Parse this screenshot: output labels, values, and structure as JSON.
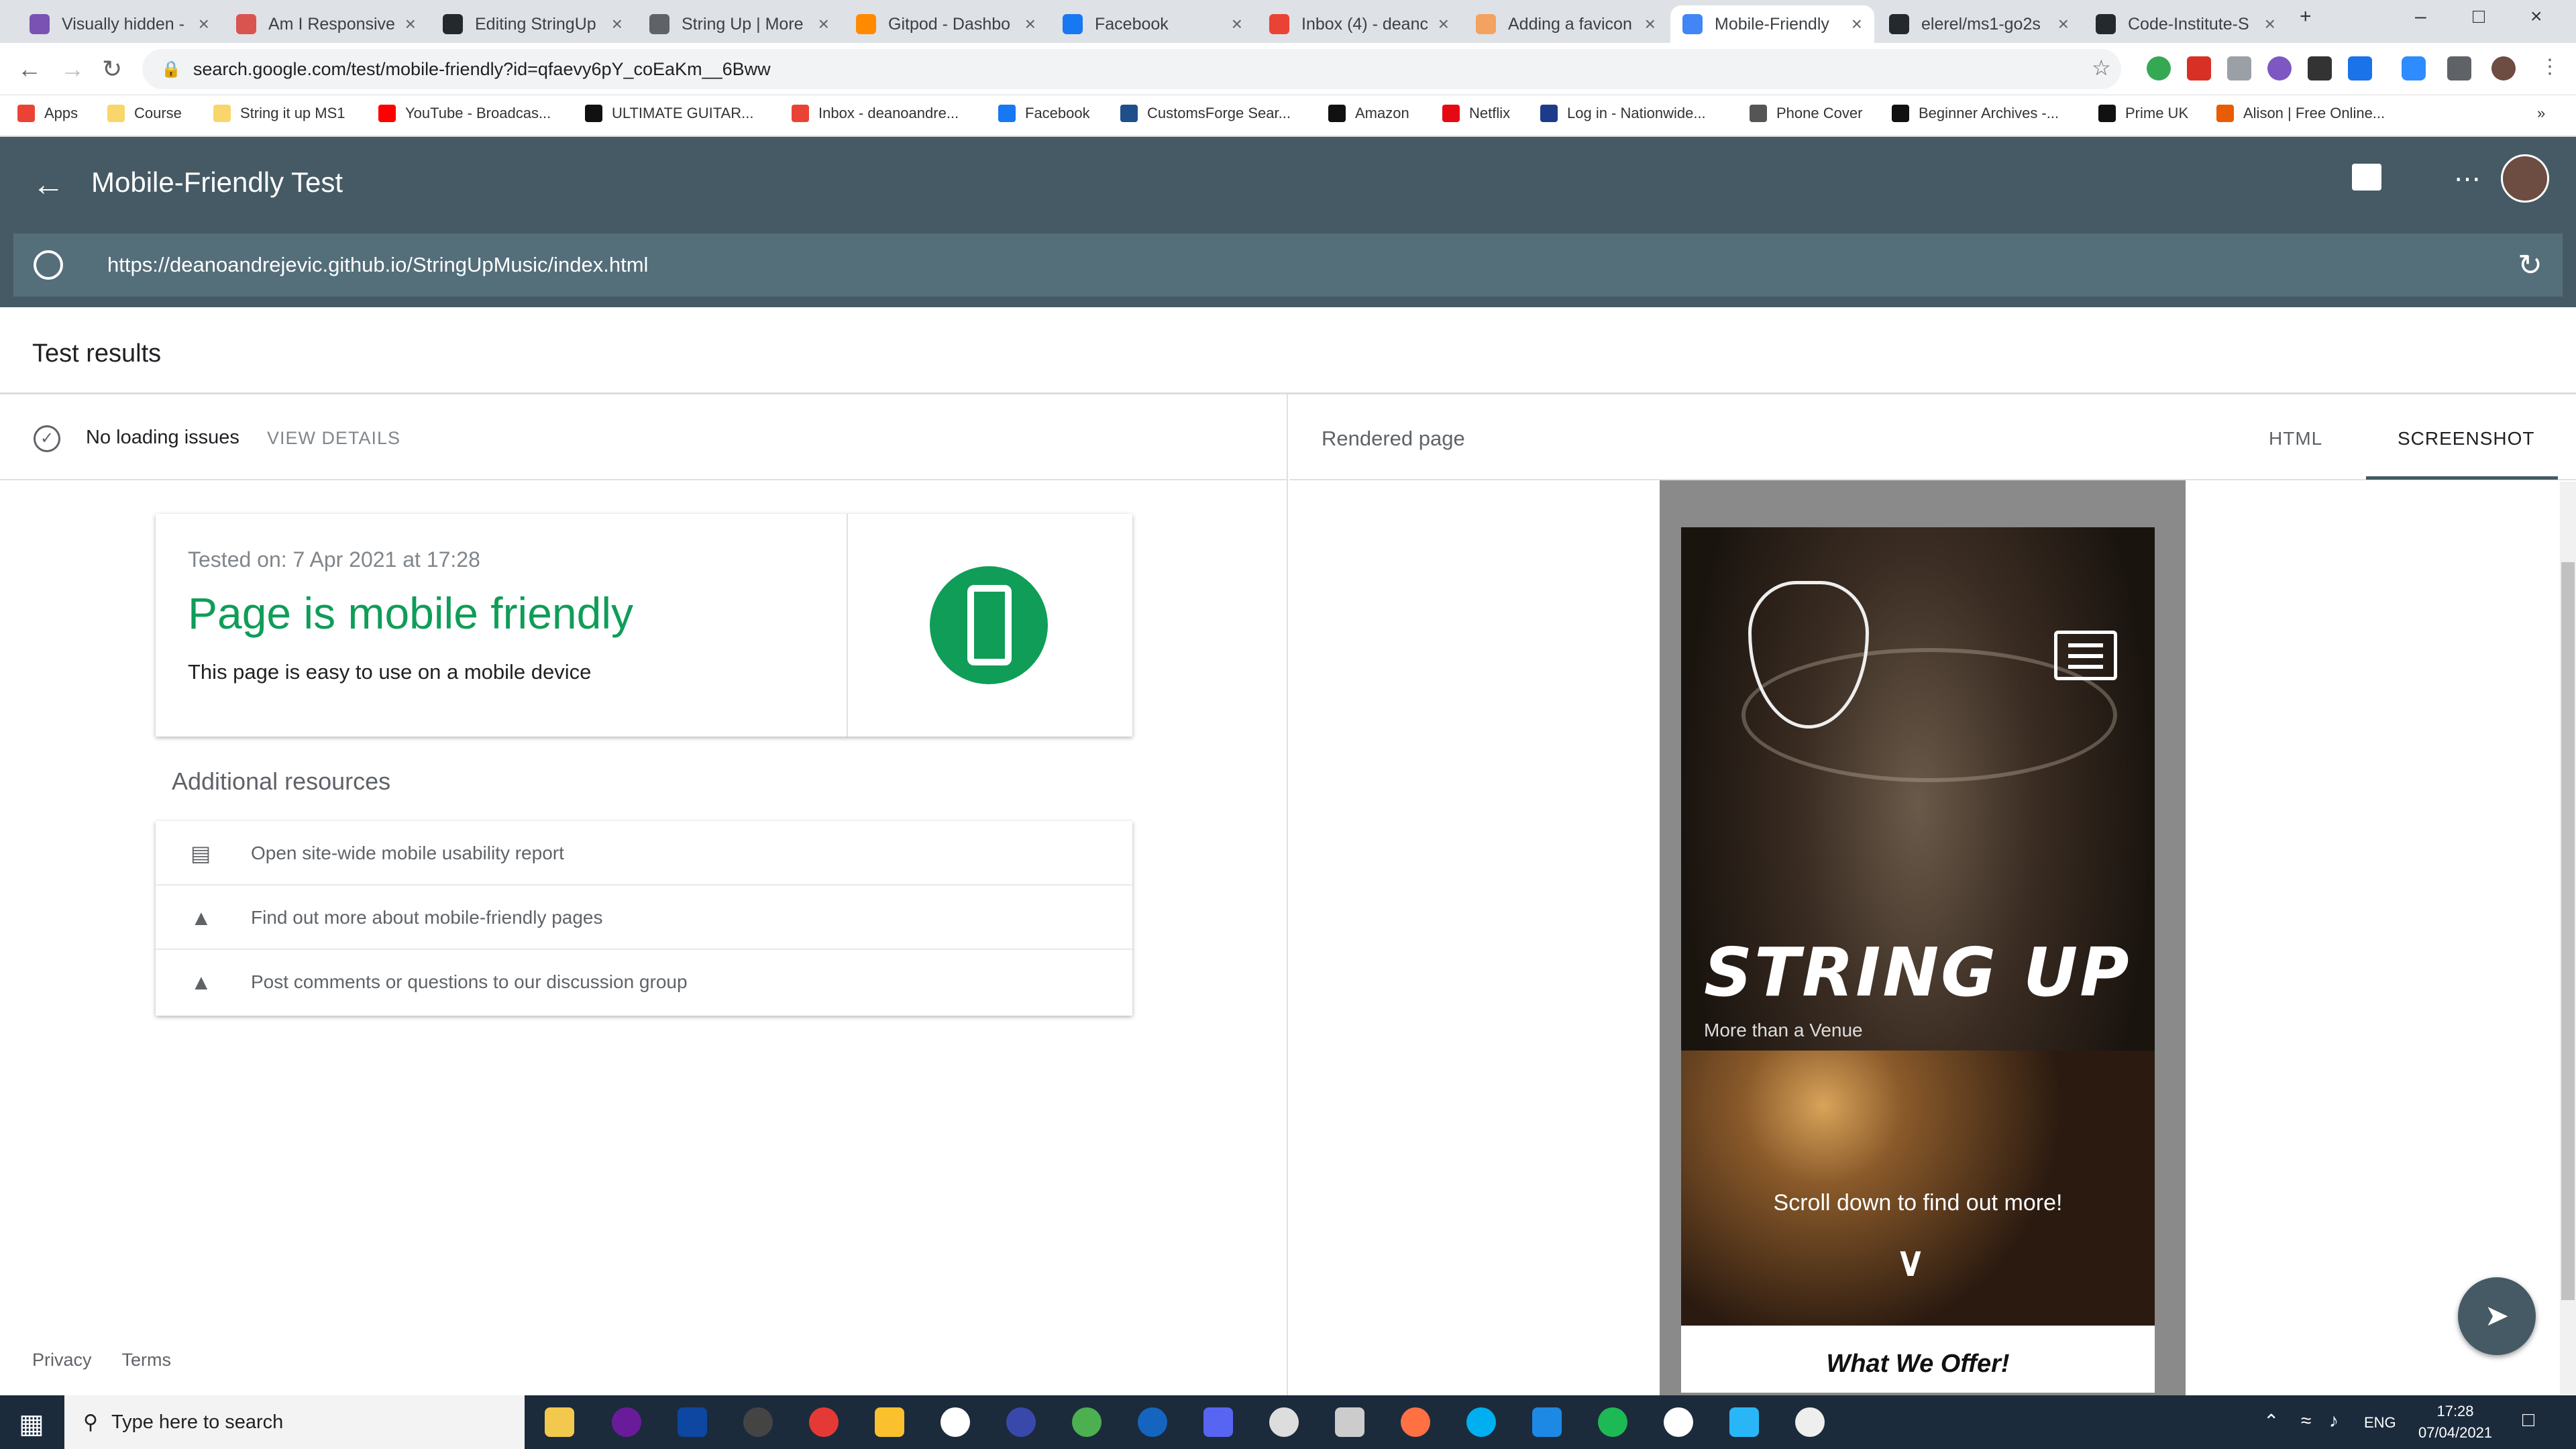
{
  "browser": {
    "tabs": [
      {
        "label": "Visually hidden -",
        "color": "#7952b3"
      },
      {
        "label": "Am I Responsive",
        "color": "#d9534f"
      },
      {
        "label": "Editing StringUp",
        "color": "#24292e"
      },
      {
        "label": "String Up | More",
        "color": "#5f6368"
      },
      {
        "label": "Gitpod - Dashbo",
        "color": "#ff8a00"
      },
      {
        "label": "Facebook",
        "color": "#1877f2"
      },
      {
        "label": "Inbox (4) - deanc",
        "color": "#ea4335"
      },
      {
        "label": "Adding a favicon",
        "color": "#f4a261"
      },
      {
        "label": "Mobile-Friendly",
        "color": "#4285f4"
      },
      {
        "label": "elerel/ms1-go2s",
        "color": "#24292e"
      },
      {
        "label": "Code-Institute-S",
        "color": "#24292e"
      }
    ],
    "url": "search.google.com/test/mobile-friendly?id=qfaevy6pY_coEaKm__6Bww",
    "bookmarks": [
      {
        "label": "Apps",
        "color": "#ea4335"
      },
      {
        "label": "Course",
        "color": "#f9d66b"
      },
      {
        "label": "String it up MS1",
        "color": "#f9d66b"
      },
      {
        "label": "YouTube - Broadcas...",
        "color": "#ff0000"
      },
      {
        "label": "ULTIMATE GUITAR...",
        "color": "#111111"
      },
      {
        "label": "Inbox - deanoandre...",
        "color": "#ea4335"
      },
      {
        "label": "Facebook",
        "color": "#1877f2"
      },
      {
        "label": "CustomsForge Sear...",
        "color": "#1f4f8a"
      },
      {
        "label": "Amazon",
        "color": "#111111"
      },
      {
        "label": "Netflix",
        "color": "#e50914"
      },
      {
        "label": "Log in - Nationwide...",
        "color": "#1d3b8a"
      },
      {
        "label": "Phone Cover",
        "color": "#555555"
      },
      {
        "label": "Beginner Archives -...",
        "color": "#111111"
      },
      {
        "label": "Prime UK",
        "color": "#111111"
      },
      {
        "label": "Alison | Free Online...",
        "color": "#e85d04"
      }
    ]
  },
  "app": {
    "title": "Mobile-Friendly Test",
    "tested_url": "https://deanoandrejevic.github.io/StringUpMusic/index.html",
    "test_results_heading": "Test results",
    "status_label": "No loading issues",
    "view_details": "VIEW DETAILS",
    "tested_on": "Tested on: 7 Apr 2021 at 17:28",
    "result_title": "Page is mobile friendly",
    "result_sub": "This page is easy to use on a mobile device",
    "additional_resources": "Additional resources",
    "resources": [
      "Open site-wide mobile usability report",
      "Find out more about mobile-friendly pages",
      "Post comments or questions to our discussion group"
    ],
    "footer": {
      "privacy": "Privacy",
      "terms": "Terms"
    },
    "rendered_page": "Rendered page",
    "tab_html": "HTML",
    "tab_screenshot": "SCREENSHOT",
    "accent": "#0f9d58",
    "header_color": "#455a64"
  },
  "preview": {
    "brand": "STRING UP",
    "tagline": "More than a Venue",
    "scroll_text": "Scroll down to find out more!",
    "section_title": "What We Offer!"
  },
  "taskbar": {
    "search_placeholder": "Type here to search",
    "language": "ENG",
    "time": "17:28",
    "date": "07/04/2021"
  }
}
